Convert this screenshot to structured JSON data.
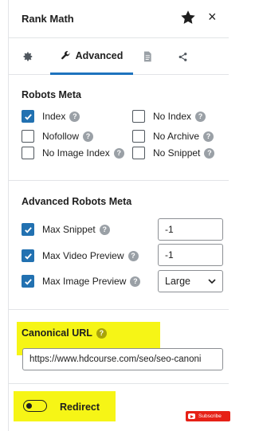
{
  "header": {
    "title": "Rank Math",
    "star_icon": "star-icon",
    "close_label": "×"
  },
  "tabs": [
    {
      "icon": "gear-icon"
    },
    {
      "icon": "wrench-icon",
      "label": "Advanced",
      "active": true
    },
    {
      "icon": "document-icon"
    },
    {
      "icon": "share-icon"
    }
  ],
  "robots_meta": {
    "title": "Robots Meta",
    "left": [
      {
        "label": "Index",
        "checked": true
      },
      {
        "label": "Nofollow",
        "checked": false
      },
      {
        "label": "No Image Index",
        "checked": false
      }
    ],
    "right": [
      {
        "label": "No Index",
        "checked": false
      },
      {
        "label": "No Archive",
        "checked": false
      },
      {
        "label": "No Snippet",
        "checked": false
      }
    ]
  },
  "advanced_robots": {
    "title": "Advanced Robots Meta",
    "rows": [
      {
        "label": "Max Snippet",
        "checked": true,
        "value": "-1"
      },
      {
        "label": "Max Video Preview",
        "checked": true,
        "value": "-1"
      },
      {
        "label": "Max Image Preview",
        "checked": true,
        "value": "Large"
      }
    ]
  },
  "canonical": {
    "label": "Canonical URL",
    "value": "https://www.hdcourse.com/seo/seo-canoni"
  },
  "redirect": {
    "label": "Redirect",
    "enabled": false
  },
  "subscribe": {
    "label": "Subscribe"
  },
  "colors": {
    "accent": "#2271b1",
    "tab_underline": "#1e73be",
    "highlight": "#f6f516",
    "youtube_red": "#e62117"
  }
}
